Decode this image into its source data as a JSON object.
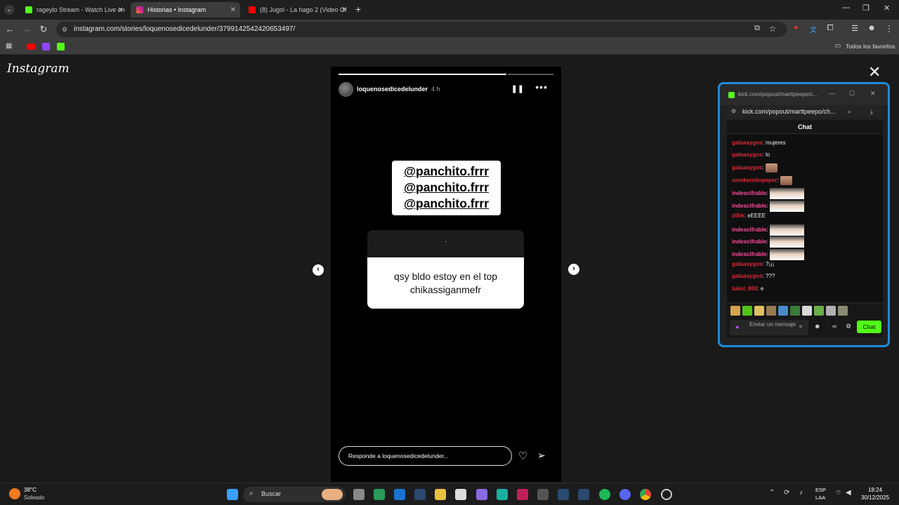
{
  "browser": {
    "tabs": [
      {
        "label": "rageylo Stream - Watch Live on",
        "active": false,
        "favicon_color": "#53fc18"
      },
      {
        "label": "Historias • Instagram",
        "active": true,
        "favicon_color": "#e1306c"
      },
      {
        "label": "(8) Jugol - La hago 2 (Video Of",
        "active": false,
        "favicon_color": "#ff0000"
      }
    ],
    "url": "instagram.com/stories/loquenosedicedelunder/3799142542420653497/",
    "bookmarks_label": "Todos los favoritos"
  },
  "instagram": {
    "logo": "Instagram",
    "close_symbol": "✕",
    "story": {
      "username": "loquenosedicedelunder",
      "time": "4 h",
      "progress": 0.78,
      "handles": [
        "@panchito.frrr",
        "@panchito.frrr",
        "@panchito.frrr"
      ],
      "question_dot": ".",
      "answer": "qsy bldo estoy en el top chikassiganmefr",
      "reply_placeholder": "Responde a loquenosedicedelunder..."
    }
  },
  "kick_popout": {
    "title_url": "kick.com/popout/marttpeepo/c...",
    "address": "kick.com/popout/marttpeepo/ch...",
    "chat_header": "Chat",
    "messages": [
      {
        "user": "galaaxygos",
        "text": "mujeres",
        "color": "#e0283a"
      },
      {
        "user": "galaaxygos",
        "text": "lo",
        "color": "#e0283a"
      },
      {
        "user": "galaaxygos",
        "text": "",
        "color": "#e0283a",
        "emote": true
      },
      {
        "user": "smokerolinpeper",
        "text": "",
        "color": "#e0283a",
        "emote": true
      },
      {
        "user": "indescifrable",
        "text": "",
        "color": "#ff4d9a",
        "pic": true
      },
      {
        "user": "indescifrable",
        "text": "",
        "color": "#ff4d9a",
        "pic": true
      },
      {
        "user": "z0hk",
        "text": "eEEEE",
        "color": "#e0283a"
      },
      {
        "user": "indescifrable",
        "text": "",
        "color": "#ff4d9a",
        "pic": true
      },
      {
        "user": "indescifrable",
        "text": "",
        "color": "#ff4d9a",
        "pic": true
      },
      {
        "user": "indescifrable",
        "text": "",
        "color": "#ff4d9a",
        "pic": true
      },
      {
        "user": "galaaxygos",
        "text": "?¡¡¡",
        "color": "#e0283a"
      },
      {
        "user": "galaaxygos",
        "text": "???",
        "color": "#e0283a"
      },
      {
        "user": "lukol_800",
        "text": "e",
        "color": "#e0283a"
      }
    ],
    "input_placeholder": "Enviar un mensaje",
    "send_label": "Chat"
  },
  "taskbar": {
    "weather_temp": "38°C",
    "weather_desc": "Soleado",
    "search_label": "Buscar",
    "language": "ESP",
    "layout": "LAA",
    "time": "18:24",
    "date": "30/12/2025"
  }
}
